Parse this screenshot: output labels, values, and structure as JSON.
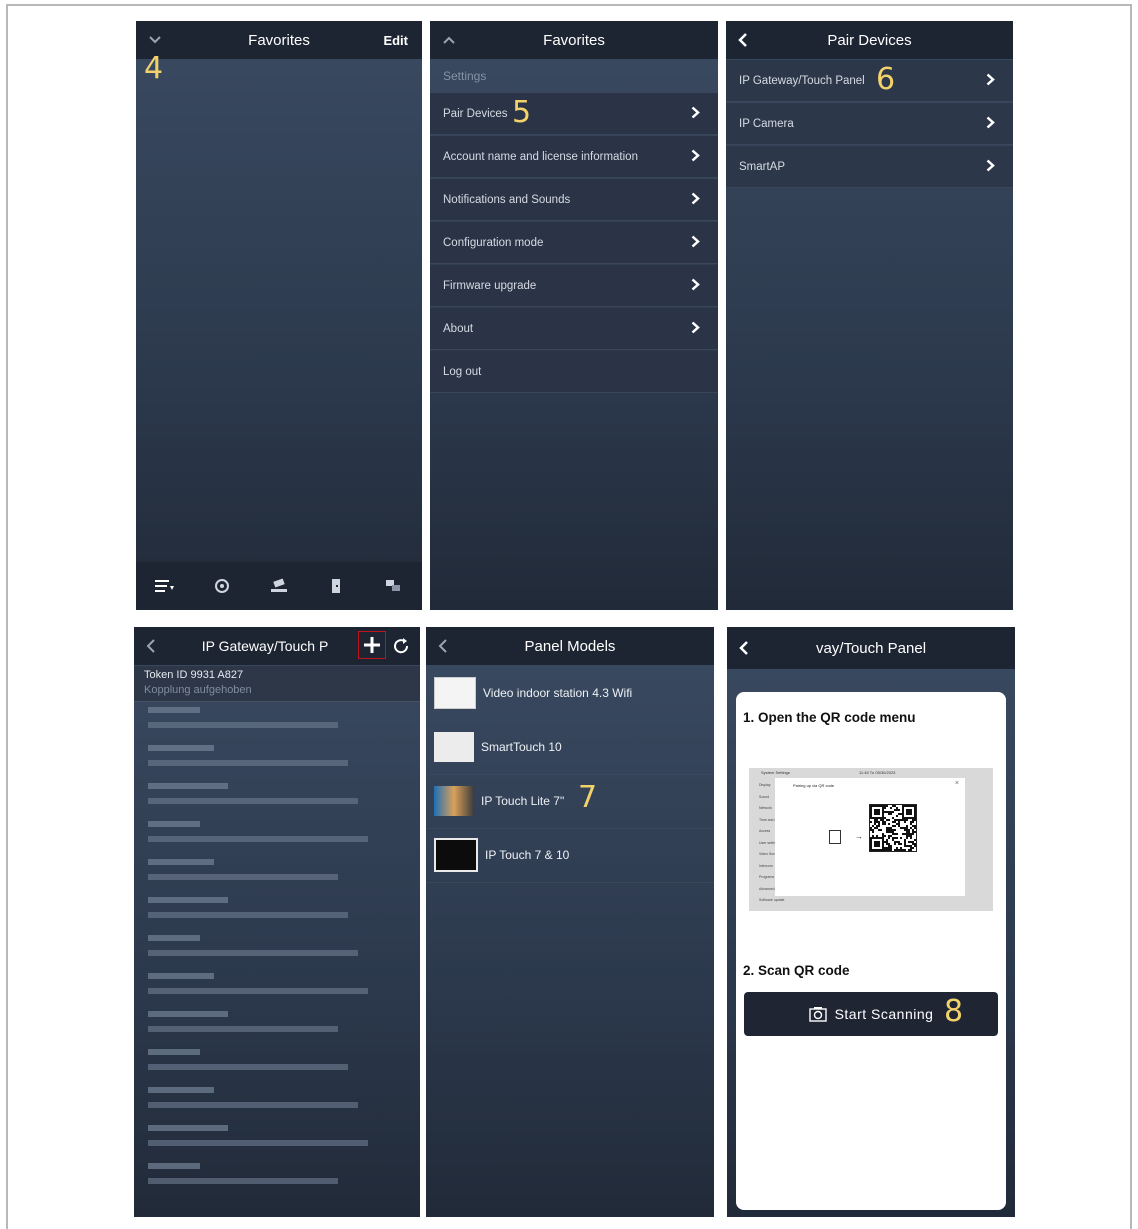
{
  "panels": {
    "p1": {
      "title": "Favorites",
      "edit_label": "Edit",
      "step": "4",
      "tabs": [
        "favorites-tab",
        "intercom-tab",
        "camera-tab",
        "door-tab",
        "messages-tab"
      ]
    },
    "p2": {
      "title": "Favorites",
      "section_header": "Settings",
      "step": "5",
      "items": [
        "Pair Devices",
        "Account name and license information",
        "Notifications and Sounds",
        "Configuration mode",
        "Firmware upgrade",
        "About",
        "Log out"
      ]
    },
    "p3": {
      "title": "Pair Devices",
      "step": "6",
      "items": [
        "IP Gateway/Touch Panel",
        "IP Camera",
        "SmartAP"
      ]
    },
    "p4": {
      "title": "IP Gateway/Touch P",
      "token": "Token ID 9931 A827",
      "status": "Kopplung aufgehoben"
    },
    "p5": {
      "title": "Panel Models",
      "step": "7",
      "models": [
        "Video indoor station 4.3 Wifi",
        "SmartTouch 10",
        "IP Touch Lite 7\"",
        "IP Touch 7 & 10"
      ]
    },
    "p6": {
      "title": "vay/Touch Panel",
      "step1": "1. Open the QR code menu",
      "step2": "2. Scan QR code",
      "scan_label": "Start Scanning",
      "step": "8",
      "screenshot": {
        "title": "System Settings",
        "time": "11:45 Tu 05/30/2023",
        "dialog_title": "Pairing up via QR code",
        "menu": [
          "Display",
          "Sound",
          "Network",
          "Time and date",
          "Access",
          "User settings",
          "Video Surveillance",
          "Intercom",
          "Programs",
          "Advanced settings",
          "Software update"
        ]
      }
    }
  },
  "colors": {
    "accent": "#f3d26a",
    "bar": "#1e2532",
    "highlight": "#c0141c"
  }
}
